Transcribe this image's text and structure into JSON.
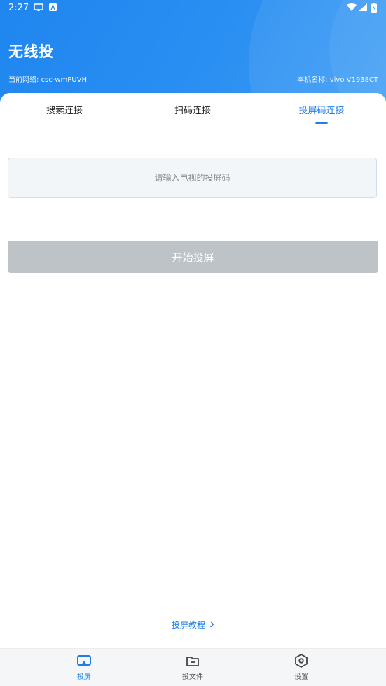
{
  "status_bar": {
    "time": "2:27",
    "icons": [
      "cast-icon",
      "a-icon",
      "wifi-icon",
      "signal-icon",
      "battery-icon"
    ]
  },
  "header": {
    "title": "无线投",
    "network_label": "当前网络: csc-wmPUVH",
    "device_label": "本机名称: vivo V1938CT",
    "gradient_start": "#1f86f0",
    "gradient_end": "#3f9df5"
  },
  "tabs": [
    {
      "label": "搜索连接",
      "active": false
    },
    {
      "label": "扫码连接",
      "active": false
    },
    {
      "label": "投屏码连接",
      "active": true
    }
  ],
  "code_input": {
    "value": "",
    "placeholder": "请输入电视的投屏码"
  },
  "start_button": {
    "label": "开始投屏",
    "enabled": false,
    "color": "#bec3c8"
  },
  "tutorial_link": {
    "label": "投屏教程",
    "icon": "chevron-right-icon"
  },
  "bottom_nav": [
    {
      "label": "投屏",
      "icon": "cast-screen-icon",
      "active": true
    },
    {
      "label": "投文件",
      "icon": "folder-icon",
      "active": false
    },
    {
      "label": "设置",
      "icon": "settings-icon",
      "active": false
    }
  ],
  "colors": {
    "accent": "#1f7fe6",
    "inactive": "#555555"
  }
}
